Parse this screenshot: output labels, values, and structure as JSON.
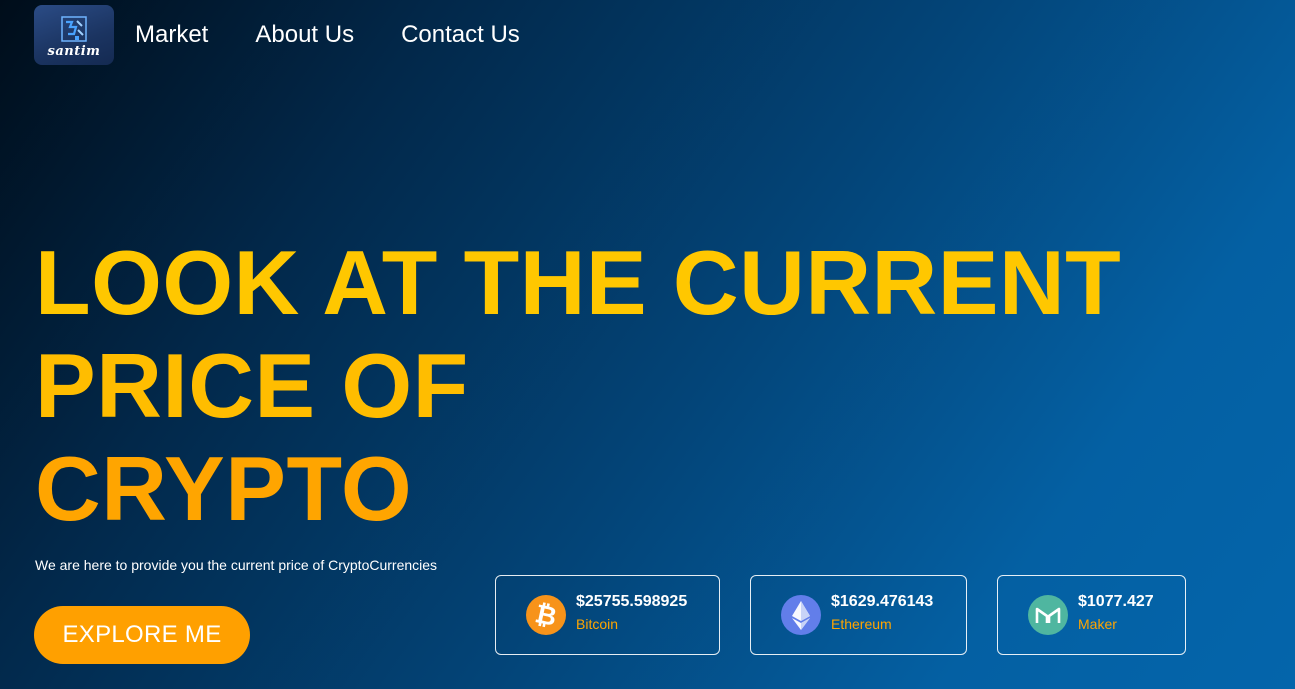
{
  "brand": {
    "logo_text": "santim"
  },
  "nav": {
    "items": [
      "Market",
      "About Us",
      "Contact Us"
    ]
  },
  "hero": {
    "title_lines": [
      "LOOK AT THE CURRENT",
      "PRICE OF",
      "CRYPTO"
    ],
    "subtitle": "We are here to provide you the current price of CryptoCurrencies",
    "cta_label": "EXPLORE ME"
  },
  "coins": [
    {
      "price": "$25755.598925",
      "name": "Bitcoin",
      "icon": "bitcoin-icon",
      "color": "#f7931a"
    },
    {
      "price": "$1629.476143",
      "name": "Ethereum",
      "icon": "ethereum-icon",
      "color": "#627eea"
    },
    {
      "price": "$1077.427",
      "name": "Maker",
      "icon": "maker-icon",
      "color": "#4fb6a0"
    }
  ],
  "colors": {
    "accent": "#ffa000",
    "title": "#ffc700"
  }
}
